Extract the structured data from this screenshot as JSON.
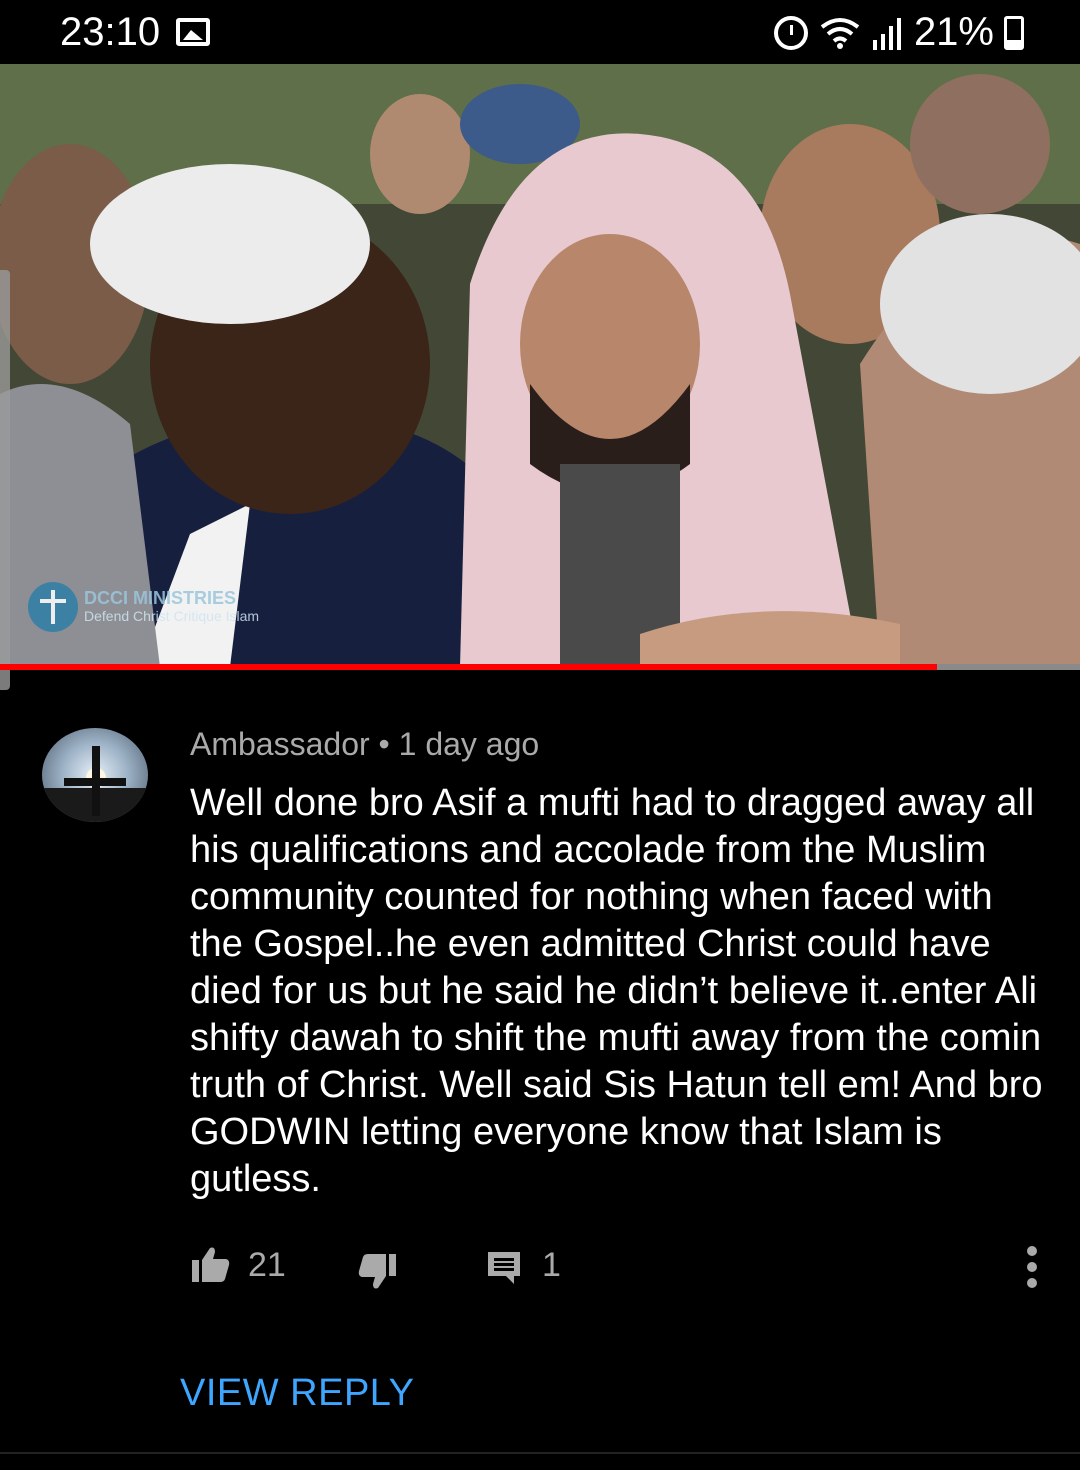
{
  "status_bar": {
    "time": "23:10",
    "battery": "21%",
    "icons": [
      "gallery-icon",
      "alarm-icon",
      "wifi-icon",
      "signal-icon",
      "battery-icon"
    ]
  },
  "video": {
    "watermark_title": "DCCI MINISTRIES",
    "watermark_subtitle": "Defend Christ Critique Islam",
    "progress_fraction": 0.868,
    "progress_color": "#ff0000"
  },
  "comment": {
    "author": "Ambassador",
    "separator": "•",
    "time_ago": "1 day ago",
    "text": "Well done bro Asif a mufti had to dragged away all his qualifications and accolade from the Muslim community counted for nothing when faced with the Gospel..he even admitted Christ could have died for us but he said he didn’t believe it..enter Ali shifty dawah to shift the mufti away from the comin truth of Christ.  Well said Sis Hatun tell em! And bro GODWIN letting everyone know that Islam is gutless.",
    "likes": "21",
    "replies": "1",
    "view_reply_label": "VIEW REPLY",
    "link_color": "#3ea6ff"
  }
}
